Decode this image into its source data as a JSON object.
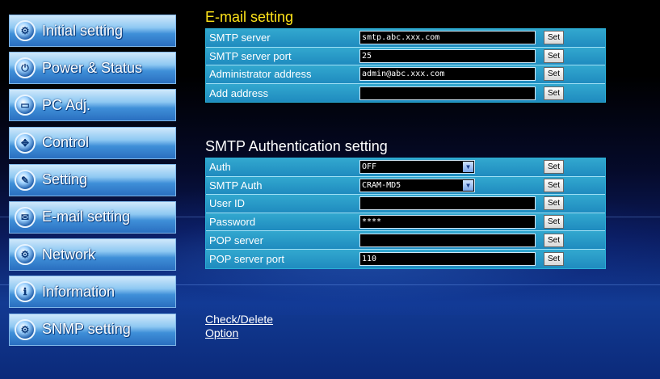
{
  "sidebar": {
    "items": [
      {
        "label": "Initial setting",
        "icon": "gear-icon",
        "glyph": "⚙"
      },
      {
        "label": "Power & Status",
        "icon": "power-icon",
        "glyph": "⏻"
      },
      {
        "label": "PC Adj.",
        "icon": "monitor-icon",
        "glyph": "▭"
      },
      {
        "label": "Control",
        "icon": "dpad-icon",
        "glyph": "✥"
      },
      {
        "label": "Setting",
        "icon": "wrench-icon",
        "glyph": "✎"
      },
      {
        "label": "E-mail setting",
        "icon": "envelope-icon",
        "glyph": "✉"
      },
      {
        "label": "Network",
        "icon": "network-icon",
        "glyph": "⚙"
      },
      {
        "label": "Information",
        "icon": "info-icon",
        "glyph": "ℹ"
      },
      {
        "label": "SNMP setting",
        "icon": "snmp-icon",
        "glyph": "⚙"
      }
    ]
  },
  "email": {
    "title": "E-mail setting",
    "rows": [
      {
        "label": "SMTP server",
        "value": "smtp.abc.xxx.com"
      },
      {
        "label": "SMTP server port",
        "value": "25"
      },
      {
        "label": "Administrator address",
        "value": "admin@abc.xxx.com"
      },
      {
        "label": "Add address",
        "value": ""
      }
    ]
  },
  "auth": {
    "title": "SMTP Authentication setting",
    "rows": [
      {
        "label": "Auth",
        "type": "select",
        "value": "OFF"
      },
      {
        "label": "SMTP Auth",
        "type": "select",
        "value": "CRAM-MD5"
      },
      {
        "label": "User ID",
        "type": "text",
        "value": ""
      },
      {
        "label": "Password",
        "type": "text",
        "value": "****"
      },
      {
        "label": "POP server",
        "type": "text",
        "value": ""
      },
      {
        "label": "POP server port",
        "type": "text",
        "value": "110"
      }
    ]
  },
  "set_label": "Set",
  "links": {
    "check_delete": "Check/Delete",
    "option": "Option"
  },
  "colors": {
    "title_email": "#ffe41a",
    "row_bg": "#1f8bbf",
    "sidebar_btn": "#3f8fd8"
  }
}
